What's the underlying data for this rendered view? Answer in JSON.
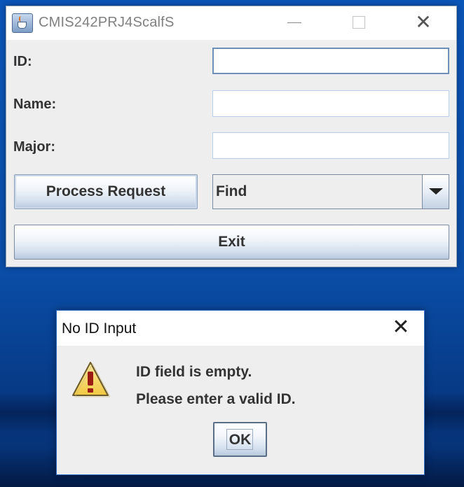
{
  "main_window": {
    "title": "CMIS242PRJ4ScalfS",
    "icons": {
      "app": "java-cup-icon",
      "minimize": "minimize-icon",
      "maximize": "maximize-icon",
      "close": "close-icon"
    },
    "form": {
      "id_label": "ID:",
      "id_value": "",
      "name_label": "Name:",
      "name_value": "",
      "major_label": "Major:",
      "major_value": ""
    },
    "process_button": "Process Request",
    "action_select": {
      "selected": "Find"
    },
    "exit_button": "Exit"
  },
  "dialog": {
    "title": "No ID Input",
    "icon": "warning-icon",
    "message_lines": [
      "ID field is empty.",
      "Please enter a valid ID."
    ],
    "ok_button": "OK"
  },
  "colors": {
    "desktop": "#0a55b8",
    "window_bg": "#eeeeee",
    "warning_fill": "#f5d85a",
    "warning_mark": "#9b1c13"
  }
}
